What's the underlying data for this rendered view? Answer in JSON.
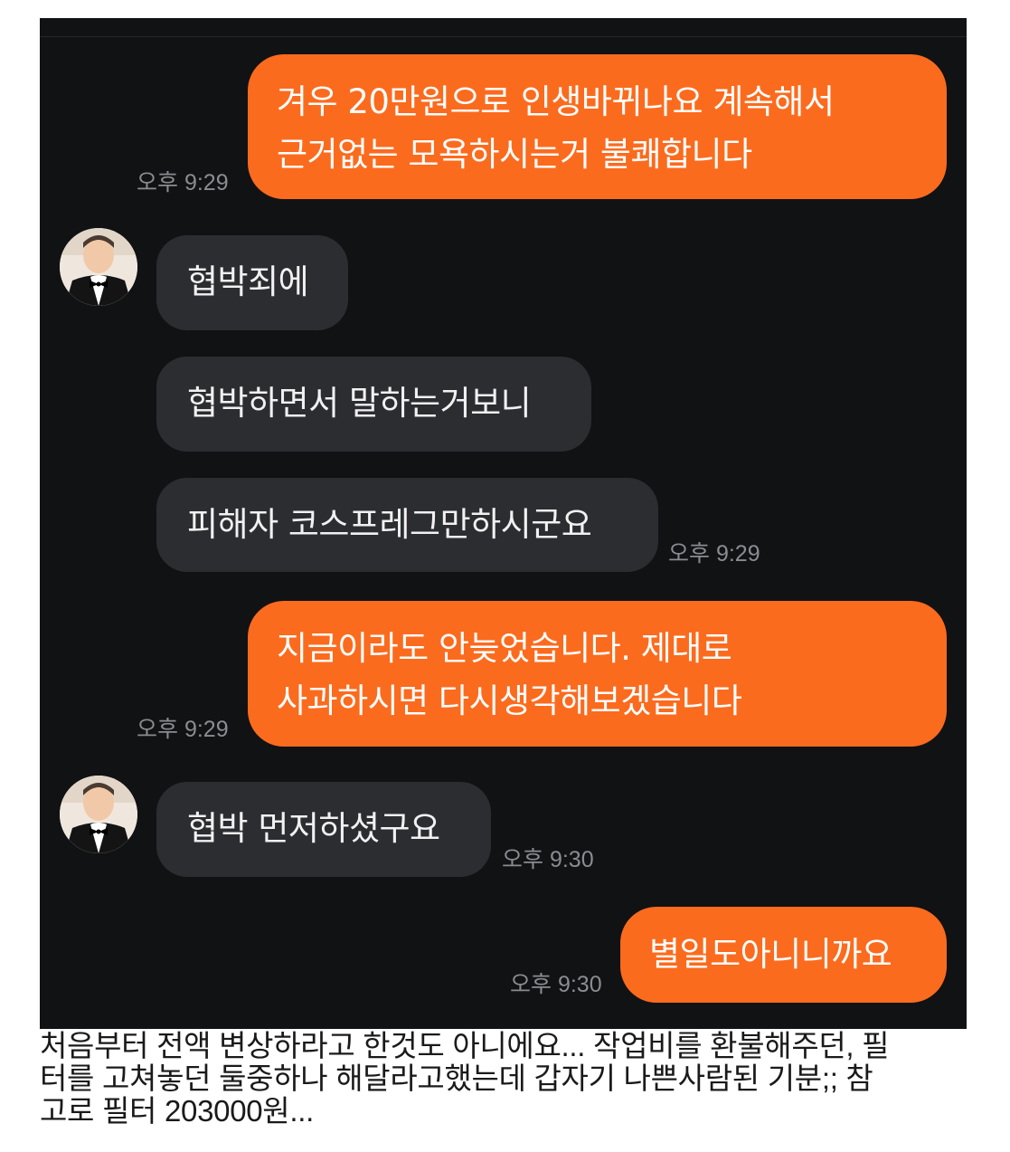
{
  "chat": {
    "messages": [
      {
        "id": "m1",
        "side": "out",
        "lines": [
          "겨우 20만원으로 인생바뀌나요 계속해서",
          "근거없는 모욕하시는거 불쾌합니다"
        ],
        "time": "오후 9:29"
      },
      {
        "id": "m2",
        "side": "in",
        "lines": [
          "협박죄에"
        ],
        "avatar": "profile-photo-tuxedo"
      },
      {
        "id": "m3",
        "side": "in",
        "lines": [
          "협박하면서 말하는거보니"
        ]
      },
      {
        "id": "m4",
        "side": "in",
        "lines": [
          "피해자 코스프레그만하시군요"
        ],
        "time": "오후 9:29"
      },
      {
        "id": "m5",
        "side": "out",
        "lines": [
          "지금이라도 안늦었습니다. 제대로",
          "사과하시면 다시생각해보겠습니다"
        ],
        "time": "오후 9:29"
      },
      {
        "id": "m6",
        "side": "in",
        "lines": [
          "협박 먼저하셨구요"
        ],
        "time": "오후 9:30",
        "avatar": "profile-photo-tuxedo"
      },
      {
        "id": "m7",
        "side": "out",
        "lines": [
          "별일도아니니까요"
        ],
        "time": "오후 9:30"
      }
    ]
  },
  "caption": {
    "lines": [
      "처음부터 전액 변상하라고 한것도 아니에요... 작업비를 환불해주던, 필",
      "터를 고쳐놓던 둘중하나 해달라고했는데 갑자기 나쁜사람된 기분;; 참",
      "고로 필터 203000원..."
    ]
  },
  "colors": {
    "chat_background": "#111214",
    "outgoing_bubble": "#fb6b1e",
    "incoming_bubble": "#2c2d31",
    "timestamp": "#8a8c91"
  }
}
